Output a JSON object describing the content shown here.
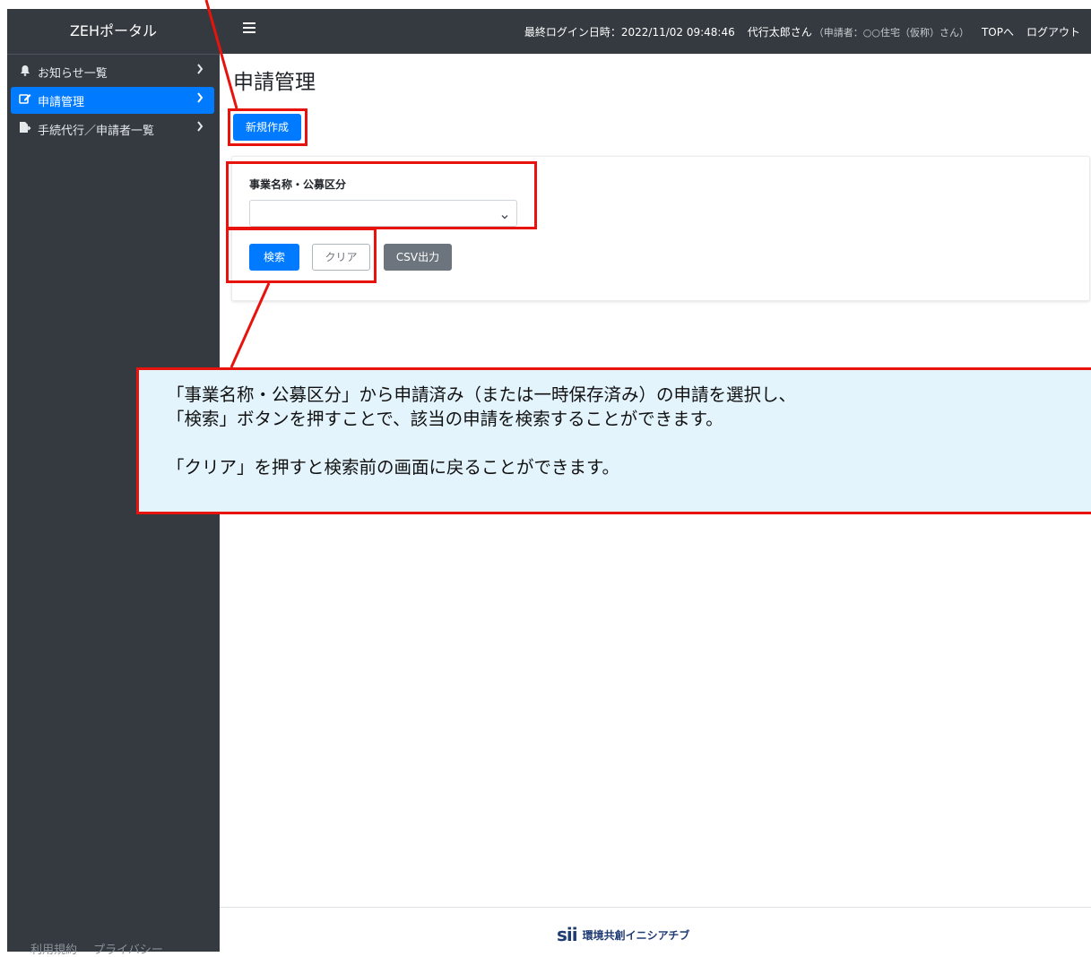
{
  "sidebar": {
    "brand": "ZEHポータル",
    "items": [
      {
        "icon": "bell-icon",
        "label": "お知らせ一覧",
        "active": false
      },
      {
        "icon": "edit-icon",
        "label": "申請管理",
        "active": true
      },
      {
        "icon": "file-export-icon",
        "label": "手続代行／申請者一覧",
        "active": false
      }
    ],
    "footer_links": [
      "利用規約",
      "プライバシー"
    ]
  },
  "topbar": {
    "last_login_label": "最終ログイン日時：",
    "last_login_value": "2022/11/02 09:48:46",
    "user_name": "代行太郎さん",
    "applicant": "（申請者：○○住宅（仮称）さん）",
    "top_link": "TOPへ",
    "logout": "ログアウト"
  },
  "main": {
    "title": "申請管理",
    "new_button": "新規作成",
    "search_panel": {
      "field_label": "事業名称・公募区分",
      "select_value": "",
      "search_button": "検索",
      "clear_button": "クリア",
      "csv_button": "CSV出力"
    }
  },
  "callout": {
    "line1": "「事業名称・公募区分」から申請済み（または一時保存済み）の申請を選択し、",
    "line2": "「検索」ボタンを押すことで、該当の申請を検索することができます。",
    "line3": "「クリア」を押すと検索前の画面に戻ることができます。"
  },
  "footer": {
    "logo_mark": "sii",
    "logo_text": "環境共創イニシアチブ"
  },
  "colors": {
    "sidebar_bg": "#343a40",
    "primary": "#007bff",
    "annotation_red": "#e8130d",
    "callout_bg": "#e3f4fd"
  }
}
